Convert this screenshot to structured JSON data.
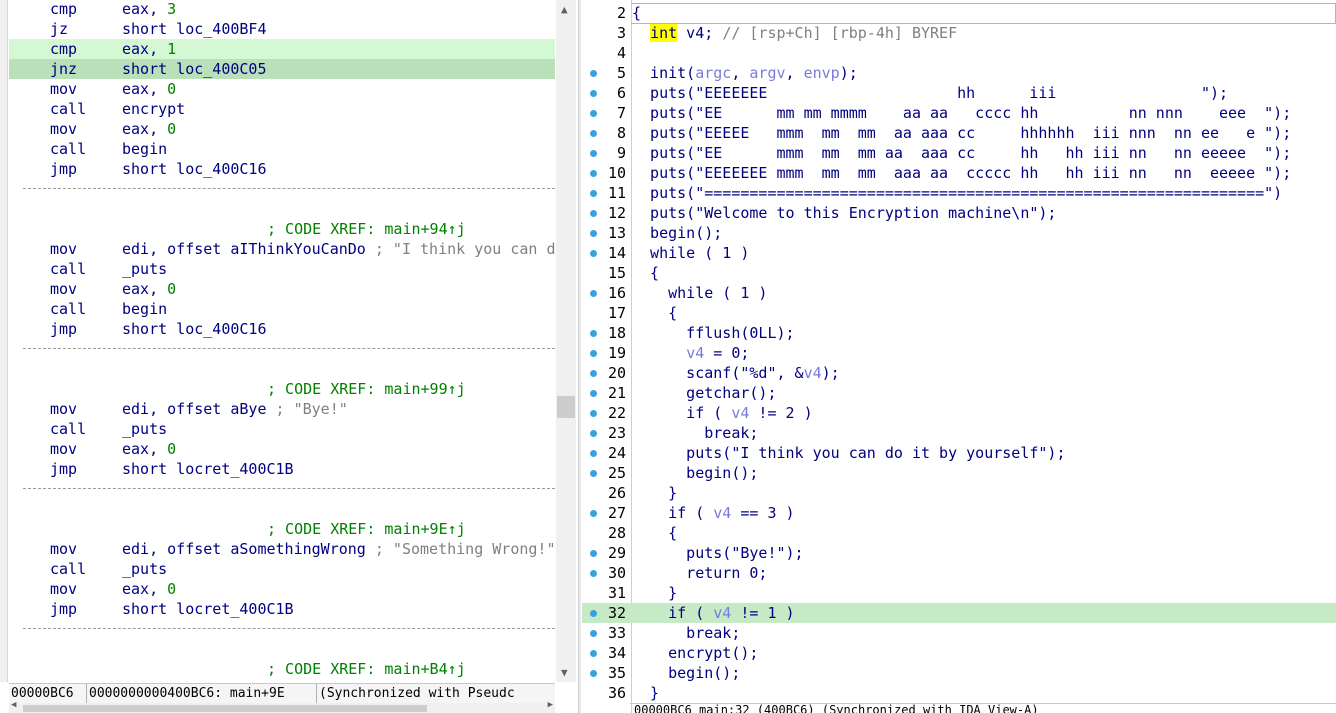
{
  "disasm": {
    "lines": [
      {
        "mn": "cmp",
        "op": "eax, ",
        "num": "3"
      },
      {
        "mn": "jz",
        "op": "short loc_400BF4"
      },
      {
        "mn": "cmp",
        "op": "eax, ",
        "num": "1"
      },
      {
        "mn": "jnz",
        "op": "short loc_400C05"
      },
      {
        "mn": "mov",
        "op": "eax, ",
        "num": "0"
      },
      {
        "mn": "call",
        "op": "encrypt"
      },
      {
        "mn": "mov",
        "op": "eax, ",
        "num": "0"
      },
      {
        "mn": "call",
        "op": "begin"
      },
      {
        "mn": "jmp",
        "op": "short loc_400C16"
      },
      {
        "xref": "; CODE XREF: main+94↑j"
      },
      {
        "mn": "mov",
        "op": "edi, offset aIThinkYouCanDo",
        "cmt": " ; \"I think you can d"
      },
      {
        "mn": "call",
        "op": "_puts"
      },
      {
        "mn": "mov",
        "op": "eax, ",
        "num": "0"
      },
      {
        "mn": "call",
        "op": "begin"
      },
      {
        "mn": "jmp",
        "op": "short loc_400C16"
      },
      {
        "xref": "; CODE XREF: main+99↑j"
      },
      {
        "mn": "mov",
        "op": "edi, offset aBye",
        "cmt": " ; \"Bye!\""
      },
      {
        "mn": "call",
        "op": "_puts"
      },
      {
        "mn": "mov",
        "op": "eax, ",
        "num": "0"
      },
      {
        "mn": "jmp",
        "op": "short locret_400C1B"
      },
      {
        "xref": "; CODE XREF: main+9E↑j"
      },
      {
        "mn": "mov",
        "op": "edi, offset aSomethingWrong",
        "cmt": " ; \"Something Wrong!\""
      },
      {
        "mn": "call",
        "op": "_puts"
      },
      {
        "mn": "mov",
        "op": "eax, ",
        "num": "0"
      },
      {
        "mn": "jmp",
        "op": "short locret_400C1B"
      },
      {
        "xref": "; CODE XREF: main+B4↑j"
      }
    ],
    "status": {
      "addr": "00000BC6",
      "full_addr": "0000000000400BC6: main+9E",
      "sync": "(Synchronized with Pseudc"
    }
  },
  "pseudocode": {
    "lines": [
      {
        "n": "2",
        "t": "{"
      },
      {
        "n": "3",
        "t": ""
      },
      {
        "n": "4",
        "t": ""
      },
      {
        "n": "5",
        "t": "  init(argc, argv, envp);"
      },
      {
        "n": "6",
        "t": "  puts(\"EEEEEEE                     hh      iii                \");"
      },
      {
        "n": "7",
        "t": "  puts(\"EE      mm mm mmmm    aa aa   cccc hh          nn nnn    eee  \");"
      },
      {
        "n": "8",
        "t": "  puts(\"EEEEE   mmm  mm  mm  aa aaa cc     hhhhhh  iii nnn  nn ee   e \");"
      },
      {
        "n": "9",
        "t": "  puts(\"EE      mmm  mm  mm aa  aaa cc     hh   hh iii nn   nn eeeee  \");"
      },
      {
        "n": "10",
        "t": "  puts(\"EEEEEEE mmm  mm  mm  aaa aa  ccccc hh   hh iii nn   nn  eeeee \");"
      },
      {
        "n": "11",
        "t": "  puts(\"==============================================================\")"
      },
      {
        "n": "12",
        "t": "  puts(\"Welcome to this Encryption machine\\n\");"
      },
      {
        "n": "13",
        "t": "  begin();"
      },
      {
        "n": "14",
        "t": "  while ( 1 )"
      },
      {
        "n": "15",
        "t": "  {"
      },
      {
        "n": "16",
        "t": "    while ( 1 )"
      },
      {
        "n": "17",
        "t": "    {"
      },
      {
        "n": "18",
        "t": "      fflush(0LL);"
      },
      {
        "n": "19",
        "t": ""
      },
      {
        "n": "20",
        "t": ""
      },
      {
        "n": "21",
        "t": "      getchar();"
      },
      {
        "n": "22",
        "t": ""
      },
      {
        "n": "23",
        "t": "        break;"
      },
      {
        "n": "24",
        "t": "      puts(\"I think you can do it by yourself\");"
      },
      {
        "n": "25",
        "t": "      begin();"
      },
      {
        "n": "26",
        "t": "    }"
      },
      {
        "n": "27",
        "t": ""
      },
      {
        "n": "28",
        "t": "    {"
      },
      {
        "n": "29",
        "t": "      puts(\"Bye!\");"
      },
      {
        "n": "30",
        "t": "      return 0;"
      },
      {
        "n": "31",
        "t": "    }"
      },
      {
        "n": "32",
        "t": ""
      },
      {
        "n": "33",
        "t": "      break;"
      },
      {
        "n": "34",
        "t": "    encrypt();"
      },
      {
        "n": "35",
        "t": "    begin();"
      },
      {
        "n": "36",
        "t": "  }"
      }
    ],
    "line3": {
      "indent": "  ",
      "kw": "int",
      "rest": " v4; ",
      "cmt": "// [rsp+Ch] [rbp-4h] BYREF"
    },
    "line19": {
      "indent": "      ",
      "var": "v4",
      "rest": " = 0;"
    },
    "line20": {
      "pre": "      scanf(\"%d\", &",
      "var": "v4",
      "post": ");"
    },
    "line22": {
      "pre": "      if ( ",
      "var": "v4",
      "post": " != 2 )"
    },
    "line27": {
      "pre": "    if ( ",
      "var": "v4",
      "post": " == 3 )"
    },
    "line32": {
      "pre": "    if ( ",
      "var": "v4",
      "post": " != 1 )"
    },
    "status": "00000BC6 main:32 (400BC6) (Synchronized with IDA View-A)"
  }
}
